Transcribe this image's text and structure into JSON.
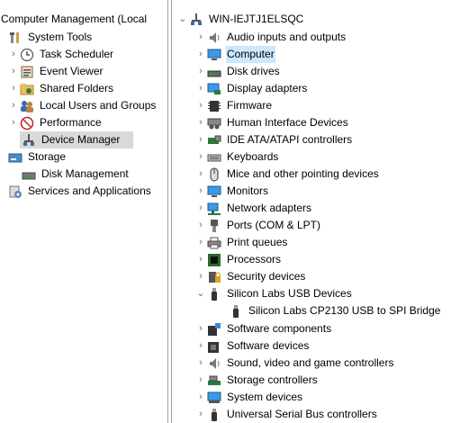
{
  "left_tree": {
    "root": "Computer Management (Local",
    "system_tools": "System Tools",
    "task_scheduler": "Task Scheduler",
    "event_viewer": "Event Viewer",
    "shared_folders": "Shared Folders",
    "local_users": "Local Users and Groups",
    "performance": "Performance",
    "device_manager": "Device Manager",
    "storage": "Storage",
    "disk_management": "Disk Management",
    "services": "Services and Applications"
  },
  "device_tree": {
    "computer_name": "WIN-IEJTJ1ELSQC",
    "categories": [
      "Audio inputs and outputs",
      "Computer",
      "Disk drives",
      "Display adapters",
      "Firmware",
      "Human Interface Devices",
      "IDE ATA/ATAPI controllers",
      "Keyboards",
      "Mice and other pointing devices",
      "Monitors",
      "Network adapters",
      "Ports (COM & LPT)",
      "Print queues",
      "Processors",
      "Security devices",
      "Silicon Labs USB Devices",
      "Silicon Labs CP2130 USB to SPI Bridge",
      "Software components",
      "Software devices",
      "Sound, video and game controllers",
      "Storage controllers",
      "System devices",
      "Universal Serial Bus controllers"
    ]
  },
  "icons": {
    "expand": "chevron-right",
    "collapse": "chevron-down"
  }
}
